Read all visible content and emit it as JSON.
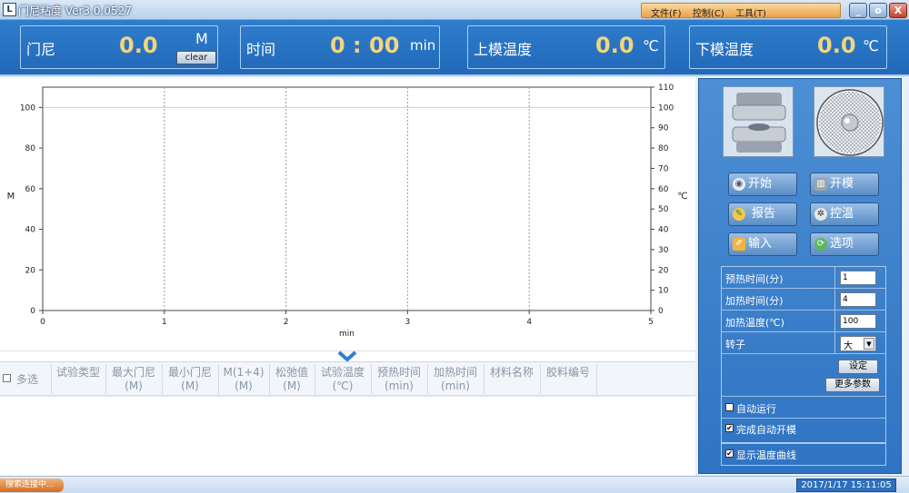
{
  "app": {
    "title": "门尼粘度 Ver3.0.0527",
    "icon_letter": "L"
  },
  "menu": {
    "file": "文件(F)",
    "control": "控制(C)",
    "tools": "工具(T)"
  },
  "window_buttons": {
    "minimize": "_",
    "maximize": "o",
    "close": "X"
  },
  "header": {
    "mooney": {
      "label": "门尼",
      "value": "0.0",
      "unit": "M",
      "clear": "clear"
    },
    "time": {
      "label": "时间",
      "value": "0 : 00",
      "unit": "min"
    },
    "upper_temp": {
      "label": "上模温度",
      "value": "0.0",
      "unit": "℃"
    },
    "lower_temp": {
      "label": "下模温度",
      "value": "0.0",
      "unit": "℃"
    }
  },
  "chart_data": {
    "type": "line",
    "xlabel": "min",
    "ylabel_left": "M",
    "ylabel_right": "℃",
    "xlim": [
      0,
      5
    ],
    "ylim_left": [
      0,
      110
    ],
    "ylim_right": [
      0,
      110
    ],
    "x_ticks": [
      "0",
      "1",
      "2",
      "3",
      "4",
      "5"
    ],
    "y_left_ticks": [
      "0",
      "20",
      "40",
      "60",
      "80",
      "100"
    ],
    "y_right_ticks": [
      "0",
      "10",
      "20",
      "30",
      "40",
      "50",
      "60",
      "70",
      "80",
      "90",
      "100",
      "110"
    ],
    "grid": "vertical",
    "series": []
  },
  "table": {
    "select_all": "多选",
    "columns": [
      {
        "line1": "试验类型",
        "line2": ""
      },
      {
        "line1": "最大门尼",
        "line2": "(M)"
      },
      {
        "line1": "最小门尼",
        "line2": "(M)"
      },
      {
        "line1": "M(1+4)",
        "line2": "(M)"
      },
      {
        "line1": "松弛值",
        "line2": "(M)"
      },
      {
        "line1": "试验温度",
        "line2": "(℃)"
      },
      {
        "line1": "预热时间",
        "line2": "(min)"
      },
      {
        "line1": "加热时间",
        "line2": "(min)"
      },
      {
        "line1": "材料名称",
        "line2": ""
      },
      {
        "line1": "胶料编号",
        "line2": ""
      }
    ]
  },
  "actions": {
    "start": "开始",
    "open_mold": "开模",
    "report": "报告",
    "temp_control": "控温",
    "input": "输入",
    "options": "选项"
  },
  "params": {
    "preheat_label": "预热时间(分)",
    "preheat_value": "1",
    "heat_label": "加热时间(分)",
    "heat_value": "4",
    "temp_label": "加热温度(℃)",
    "temp_value": "100",
    "rotor_label": "转子",
    "rotor_value": "大",
    "set_btn": "设定",
    "more_btn": "更多参数"
  },
  "options": {
    "auto_run": "自动运行",
    "auto_run_checked": false,
    "auto_open": "完成自动开模",
    "auto_open_checked": true,
    "show_temp": "显示温度曲线",
    "show_temp_checked": true
  },
  "status": {
    "left": "搜索连接中...",
    "datetime": "2017/1/17 15:11:05"
  },
  "colors": {
    "header_bg": "#2f7ecd",
    "value": "#f3d57b",
    "side_bg": "#3f82cc",
    "menu_bg": "#eca24a"
  }
}
